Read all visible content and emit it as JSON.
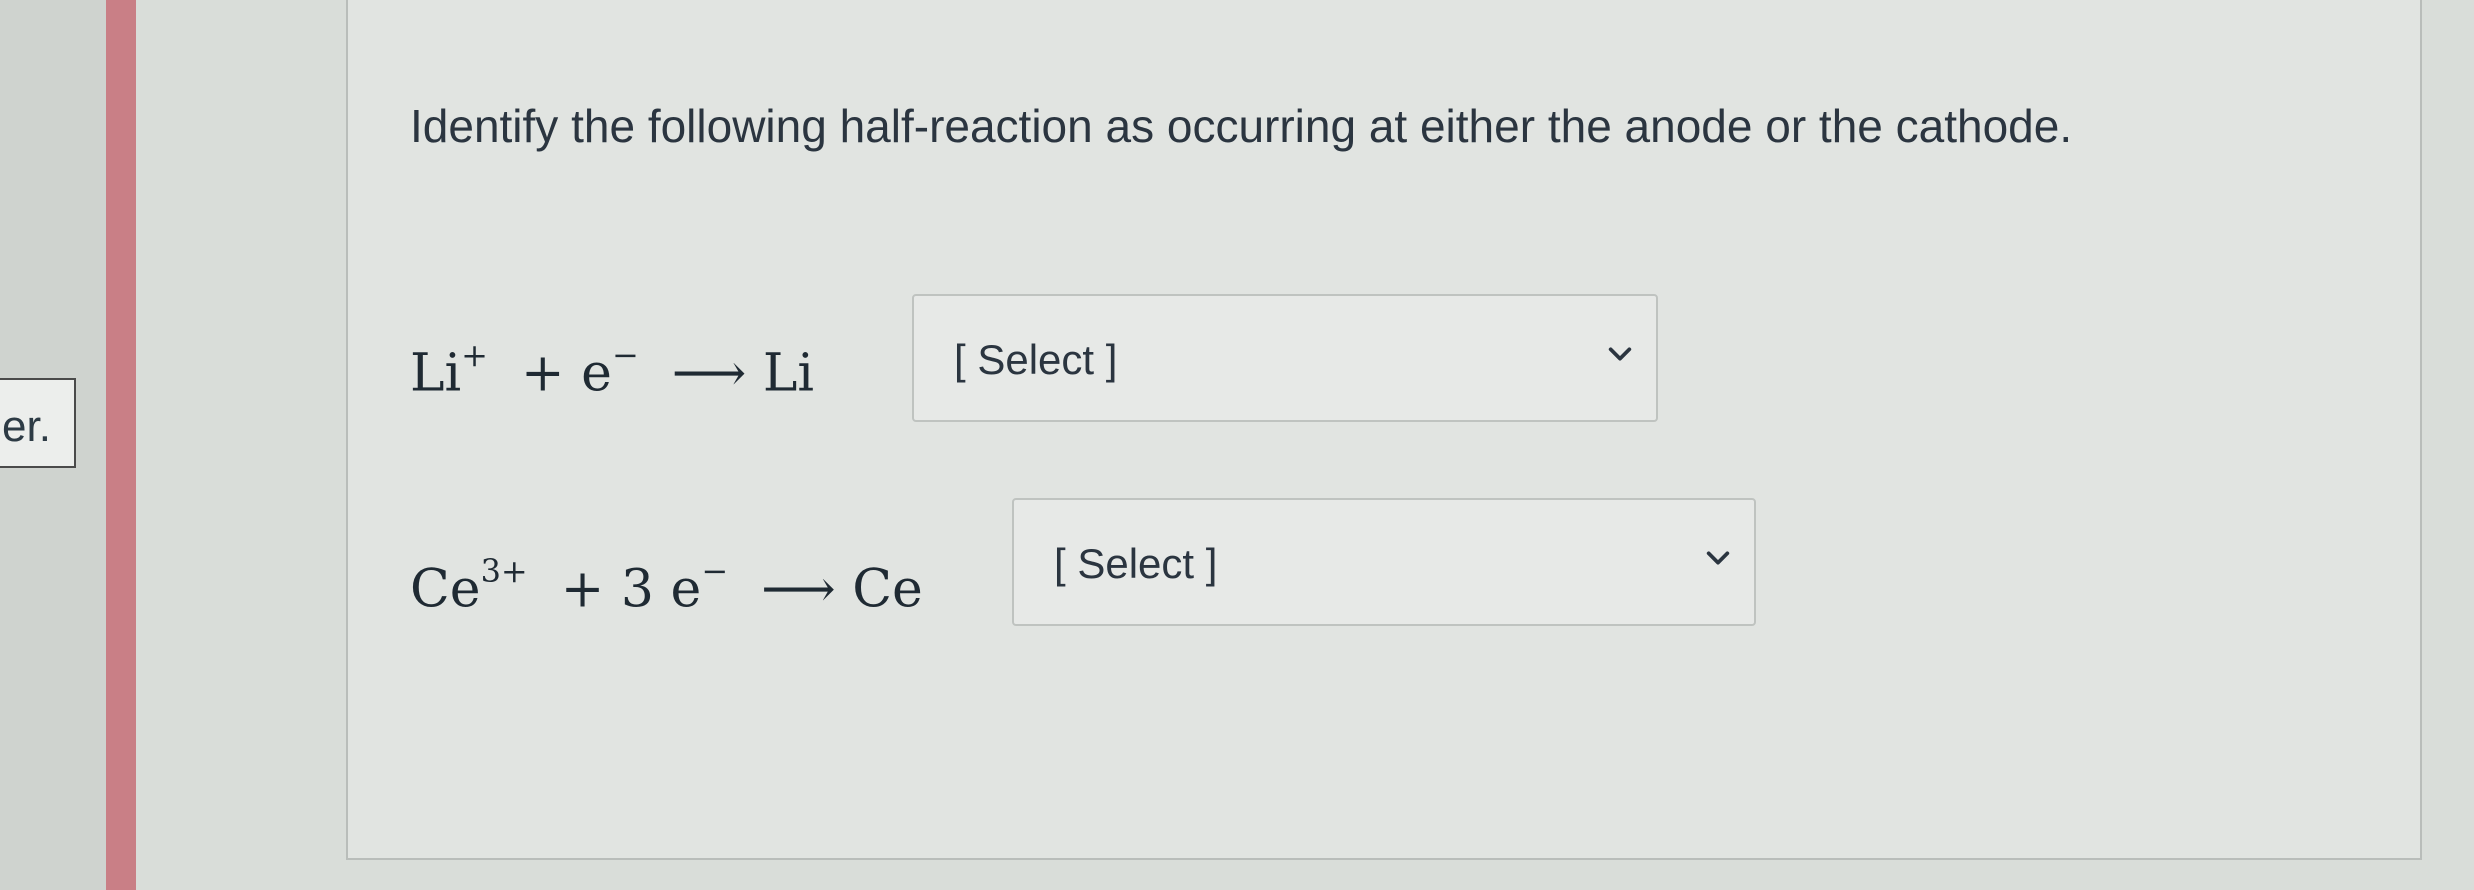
{
  "prior_question": {
    "fragment": "er."
  },
  "question": {
    "prompt": "Identify the following half-reaction as occurring at either the anode or the cathode."
  },
  "reactions": [
    {
      "reactant": "Li",
      "reactant_charge": "+",
      "electrons": "e",
      "electron_charge": "−",
      "product": "Li",
      "select_value": "[ Select ]"
    },
    {
      "reactant": "Ce",
      "reactant_charge": "3+",
      "coefficient": "3",
      "electrons": "e",
      "electron_charge": "−",
      "product": "Ce",
      "select_value": "[ Select ]"
    }
  ],
  "icons": {
    "dropdown": "chevron-down-icon"
  },
  "colors": {
    "accent_bar": "#c97f86",
    "card_bg": "#e1e4e1"
  }
}
